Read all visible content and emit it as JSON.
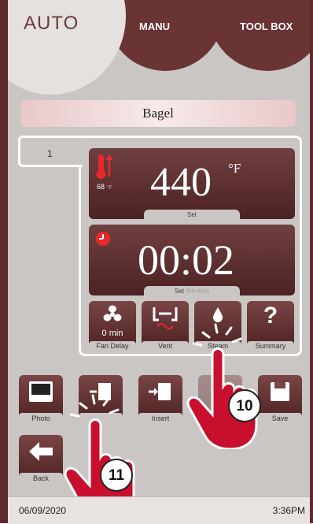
{
  "tabs": {
    "auto": "AUTO",
    "manu": "MANU",
    "toolbox": "TOOL BOX"
  },
  "recipe": {
    "name": "Bagel",
    "step_number": "1"
  },
  "temperature": {
    "value": "440",
    "unit": "°F",
    "actual": "68",
    "actual_unit": "°F",
    "label": "Set"
  },
  "timer": {
    "value": "00:02",
    "label": "Set",
    "label_hint": "(hh:mm)"
  },
  "step_buttons": [
    {
      "label": "Fan Delay",
      "value": "0 min",
      "icon": "fan-icon"
    },
    {
      "label": "Vent",
      "icon": "vent-icon"
    },
    {
      "label": "Steam",
      "icon": "steam-drop-icon"
    },
    {
      "label": "Summary",
      "icon": "question-icon"
    }
  ],
  "actions": {
    "photo": "Photo",
    "delete": "",
    "insert": "Insert",
    "save": "Save",
    "back": "Back"
  },
  "callouts": [
    "10",
    "11"
  ],
  "status": {
    "date": "06/09/2020",
    "time": "3:36PM"
  },
  "colors": {
    "accent": "#5e2b2b",
    "panel": "#5a2828",
    "callout": "#c8102e"
  }
}
